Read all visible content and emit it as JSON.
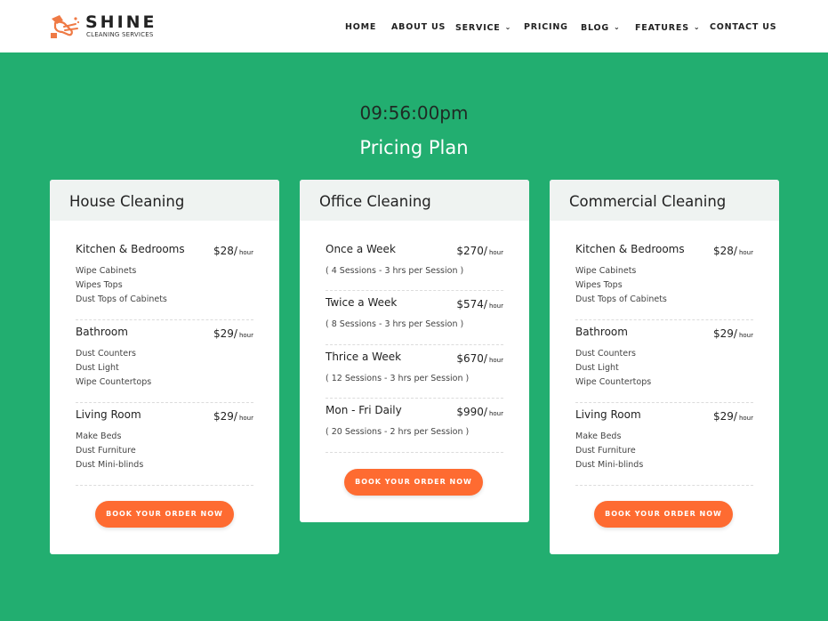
{
  "brand": {
    "name": "SHINE",
    "tagline": "CLEANING SERVICES"
  },
  "nav": [
    {
      "label": "HOME",
      "has_dropdown": false
    },
    {
      "label": "ABOUT US",
      "has_dropdown": false
    },
    {
      "label": "SERVICE",
      "has_dropdown": true
    },
    {
      "label": "PRICING",
      "has_dropdown": false
    },
    {
      "label": "BLOG",
      "has_dropdown": true
    },
    {
      "label": "FEATURES",
      "has_dropdown": true
    },
    {
      "label": "CONTACT US",
      "has_dropdown": false
    }
  ],
  "clock": "09:56:00pm",
  "section_title": "Pricing Plan",
  "colors": {
    "background": "#22ae70",
    "accent": "#fe6b31",
    "card_header": "#eff3f1",
    "logo_icon": "#ef7a45"
  },
  "plans": [
    {
      "title": "House Cleaning",
      "items": [
        {
          "name": "Kitchen & Bedrooms",
          "price": "$28/",
          "unit": "hour",
          "details": [
            "Wipe Cabinets",
            "Wipes Tops",
            "Dust Tops of Cabinets"
          ]
        },
        {
          "name": "Bathroom",
          "price": "$29/",
          "unit": "hour",
          "details": [
            "Dust Counters",
            "Dust Light",
            "Wipe Countertops"
          ]
        },
        {
          "name": "Living Room",
          "price": "$29/",
          "unit": "hour",
          "details": [
            "Make Beds",
            "Dust Furniture",
            "Dust Mini-blinds"
          ]
        }
      ],
      "button": "BOOK YOUR ORDER NOW"
    },
    {
      "title": "Office Cleaning",
      "items": [
        {
          "name": "Once a Week",
          "price": "$270/",
          "unit": "hour",
          "details": [
            "( 4 Sessions - 3 hrs per Session )"
          ]
        },
        {
          "name": "Twice a Week",
          "price": "$574/",
          "unit": "hour",
          "details": [
            "( 8 Sessions - 3 hrs per Session )"
          ]
        },
        {
          "name": "Thrice a Week",
          "price": "$670/",
          "unit": "hour",
          "details": [
            "( 12 Sessions - 3 hrs per Session )"
          ]
        },
        {
          "name": "Mon - Fri Daily",
          "price": "$990/",
          "unit": "hour",
          "details": [
            "( 20 Sessions - 2 hrs per Session )"
          ]
        }
      ],
      "button": "BOOK YOUR ORDER NOW"
    },
    {
      "title": "Commercial Cleaning",
      "items": [
        {
          "name": "Kitchen & Bedrooms",
          "price": "$28/",
          "unit": "hour",
          "details": [
            "Wipe Cabinets",
            "Wipes Tops",
            "Dust Tops of Cabinets"
          ]
        },
        {
          "name": "Bathroom",
          "price": "$29/",
          "unit": "hour",
          "details": [
            "Dust Counters",
            "Dust Light",
            "Wipe Countertops"
          ]
        },
        {
          "name": "Living Room",
          "price": "$29/",
          "unit": "hour",
          "details": [
            "Make Beds",
            "Dust Furniture",
            "Dust Mini-blinds"
          ]
        }
      ],
      "button": "BOOK YOUR ORDER NOW"
    }
  ]
}
